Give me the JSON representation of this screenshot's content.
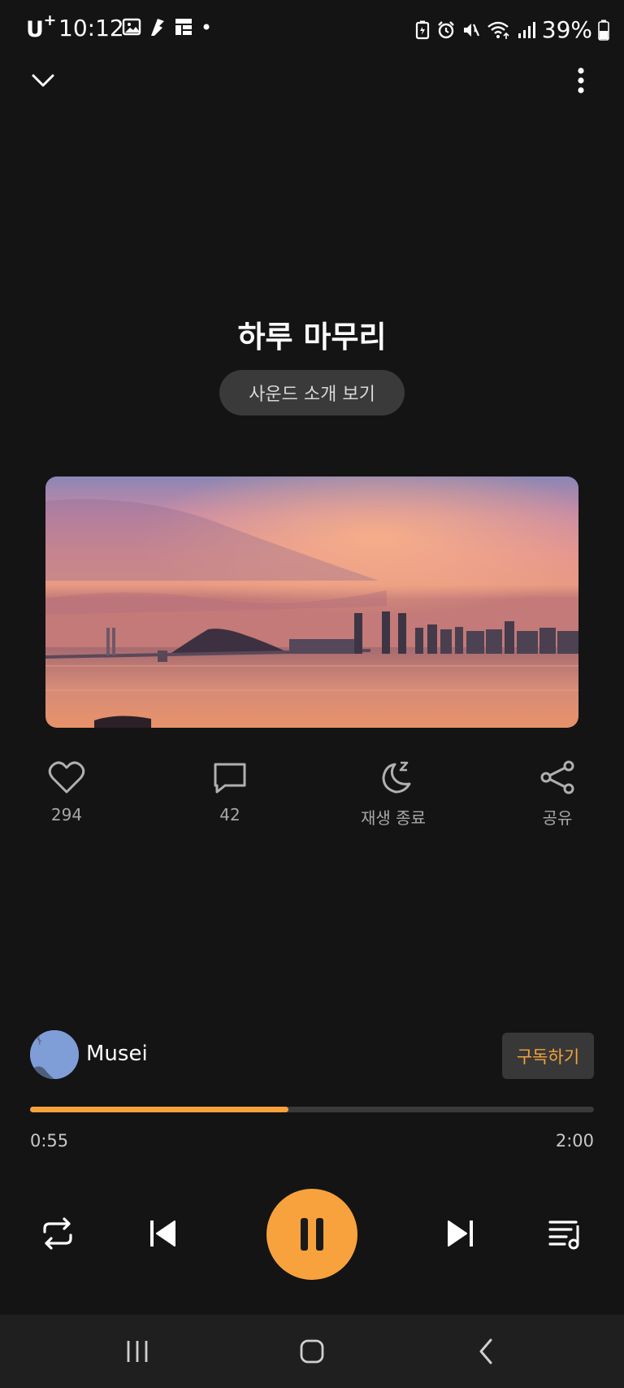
{
  "status_bar": {
    "carrier": "U",
    "carrier_sup": "+",
    "time": "10:12",
    "battery_percent": "39%",
    "icons_left": [
      "gallery-icon",
      "notification-app-icon",
      "widget-icon",
      "dot-icon"
    ],
    "icons_right": [
      "battery-saver-icon",
      "alarm-icon",
      "mute-icon",
      "wifi-icon",
      "signal-icon",
      "battery-icon"
    ]
  },
  "header": {
    "collapse_icon": "chevron-down-icon",
    "more_icon": "more-vertical-icon"
  },
  "track": {
    "title": "하루 마무리",
    "intro_button_label": "사운드 소개 보기"
  },
  "actions": {
    "like": {
      "icon": "heart-icon",
      "label": "294"
    },
    "comment": {
      "icon": "comment-icon",
      "label": "42"
    },
    "sleep_timer": {
      "icon": "moon-sleep-icon",
      "label": "재생 종료"
    },
    "share": {
      "icon": "share-icon",
      "label": "공유"
    }
  },
  "artist": {
    "name": "Musei",
    "subscribe_label": "구독하기"
  },
  "playback": {
    "elapsed": "0:55",
    "total": "2:00",
    "progress": 0.458
  },
  "controls": {
    "repeat_icon": "repeat-icon",
    "previous_icon": "skip-previous-icon",
    "pause_icon": "pause-icon",
    "next_icon": "skip-next-icon",
    "playlist_icon": "playlist-icon"
  },
  "colors": {
    "background": "#141414",
    "accent": "#f7a23c",
    "muted_text": "#a8a8a8"
  }
}
